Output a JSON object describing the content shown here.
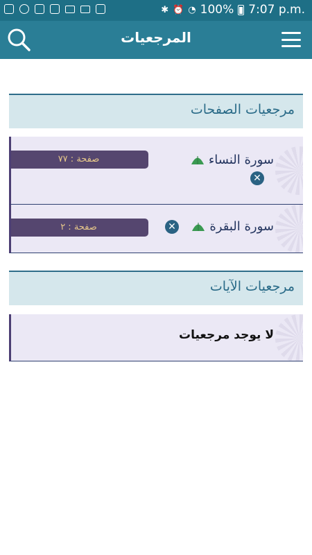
{
  "status_bar": {
    "battery": "100%",
    "time": "7:07 p.m."
  },
  "header": {
    "title": "المرجعيات"
  },
  "pages_section": {
    "title": "مرجعيات الصفحات",
    "items": [
      {
        "surah": "سورة النساء",
        "page": "صفحة : ٧٧"
      },
      {
        "surah": "سورة البقرة",
        "page": "صفحة : ٢"
      }
    ]
  },
  "verses_section": {
    "title": "مرجعيات الآيات",
    "empty_text": "لا يوجد مرجعيات"
  },
  "colors": {
    "appbar": "#2a7e96",
    "statusbar": "#1e6f86",
    "section_header_bg": "#d5e7ec",
    "card_bg": "#ebe8f5",
    "pill": "#55466f",
    "pill_text": "#e8c98a",
    "dome": "#3a9a52"
  }
}
